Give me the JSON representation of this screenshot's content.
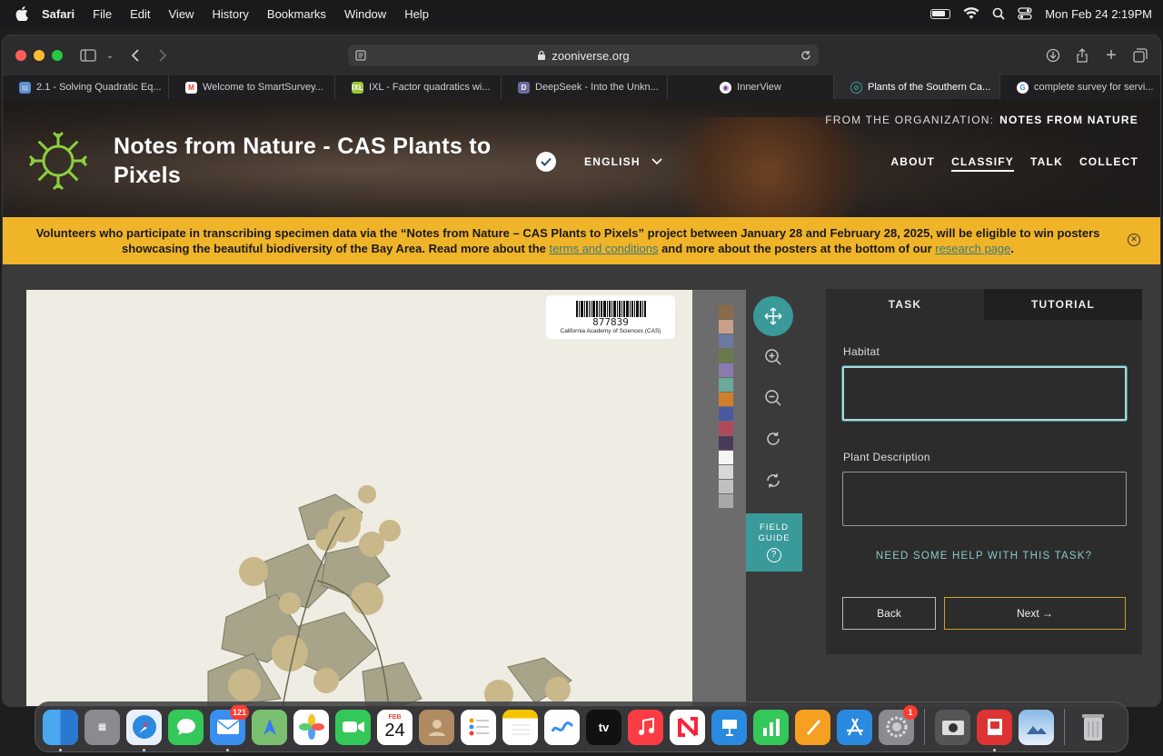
{
  "menubar": {
    "app": "Safari",
    "items": [
      "File",
      "Edit",
      "View",
      "History",
      "Bookmarks",
      "Window",
      "Help"
    ],
    "datetime": "Mon Feb 24  2:19PM"
  },
  "browser": {
    "url": "zooniverse.org",
    "tabs": [
      {
        "label": "2.1 - Solving Quadratic Eq...",
        "icon": "book-icon",
        "color": "#5b8fd6"
      },
      {
        "label": "Welcome to SmartSurvey...",
        "icon": "gmail-icon",
        "color": "#ea4335"
      },
      {
        "label": "IXL - Factor quadratics wi...",
        "icon": "ixl-icon",
        "color": "#9bc63b"
      },
      {
        "label": "DeepSeek - Into the Unkn...",
        "icon": "d-icon",
        "color": "#6b6b9a"
      },
      {
        "label": "InnerView",
        "icon": "innerview-icon",
        "color": "#ffffff"
      },
      {
        "label": "Plants of the Southern Ca...",
        "icon": "zooniverse-icon",
        "color": "#3a9a9a"
      },
      {
        "label": "complete survey for servi...",
        "icon": "google-icon",
        "color": "#4285f4"
      }
    ]
  },
  "project": {
    "title": "Notes from Nature - CAS Plants to Pixels",
    "language": "ENGLISH",
    "org_label": "FROM THE ORGANIZATION:",
    "org_name": "NOTES FROM NATURE",
    "nav": [
      "ABOUT",
      "CLASSIFY",
      "TALK",
      "COLLECT"
    ]
  },
  "banner": {
    "text_1": "Volunteers who participate in transcribing specimen data via the “Notes from Nature – CAS Plants to Pixels” project between January 28 and February 28, 2025, will be eligible to win posters showcasing the beautiful biodiversity of the Bay Area. Read more about the ",
    "link_1": "terms and conditions",
    "text_2": " and more about the posters at the bottom of our ",
    "link_2": "research page",
    "text_3": "."
  },
  "specimen": {
    "barcode": "877839",
    "institution": "California Academy of Sciences (CAS)",
    "swatches": [
      "#8a6a4a",
      "#c8a08a",
      "#6a7aa0",
      "#6a7a4a",
      "#8a7ab0",
      "#6aaa9a",
      "#d0802a",
      "#4a5aa0",
      "#b04a5a",
      "#4a3a5a",
      "#f5f5f5",
      "#d8d8d8",
      "#c0c0c0",
      "#a8a8a8"
    ]
  },
  "viewer": {
    "field_guide": "FIELD GUIDE"
  },
  "task": {
    "tab_task": "TASK",
    "tab_tutorial": "TUTORIAL",
    "habitat_label": "Habitat",
    "habitat_value": "",
    "description_label": "Plant Description",
    "description_value": "",
    "help": "NEED SOME HELP WITH THIS TASK?",
    "back": "Back",
    "next": "Next →"
  },
  "dock": {
    "mail_badge": "121",
    "calendar_month": "FEB",
    "calendar_day": "24",
    "settings_badge": "1",
    "tv_label": "tv"
  }
}
